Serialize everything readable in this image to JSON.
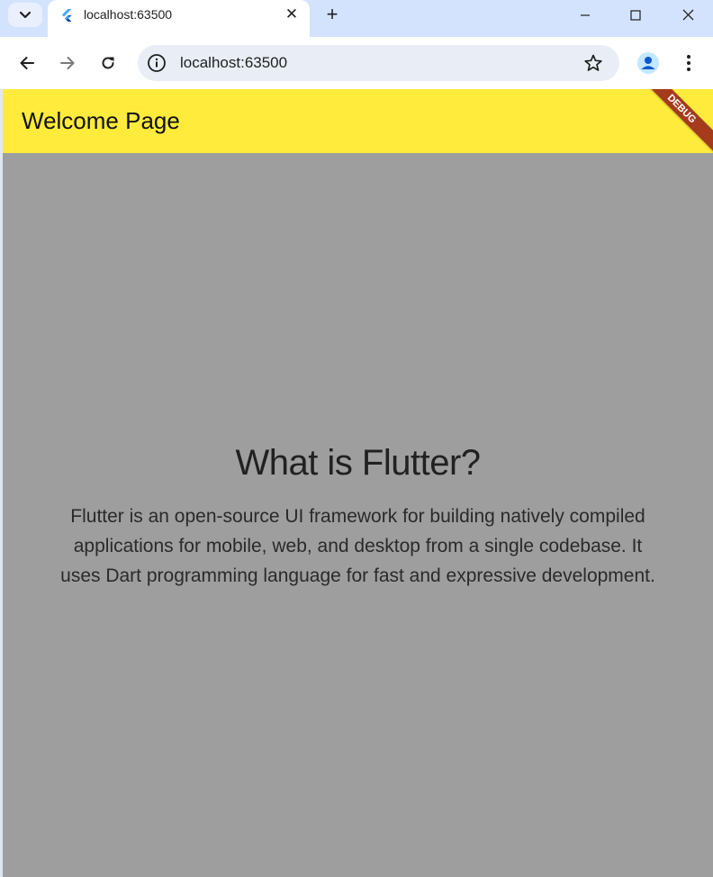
{
  "browser": {
    "tab": {
      "title": "localhost:63500",
      "close_glyph": "✕"
    },
    "new_tab_glyph": "+",
    "address": {
      "url": "localhost:63500"
    },
    "icons": {
      "tab_search": "chevron-down-icon",
      "favicon": "flutter-logo-icon",
      "back": "arrow-left-icon",
      "forward": "arrow-right-icon",
      "reload": "reload-icon",
      "site_info": "info-icon",
      "bookmark": "star-icon",
      "profile": "person-icon",
      "menu": "more-vert-icon"
    }
  },
  "app": {
    "appbar_title": "Welcome Page",
    "debug_banner": "DEBUG",
    "heading": "What is Flutter?",
    "body_lines": [
      "Flutter is an open-source UI framework for building natively compiled",
      "applications for mobile, web, and desktop from a single codebase. It",
      "uses Dart programming language for fast and expressive development."
    ]
  },
  "colors": {
    "appbar": "#ffeb3b",
    "background": "#9e9e9e",
    "debug_banner": "#a33b1c",
    "tab_strip": "#d3e3fd"
  }
}
